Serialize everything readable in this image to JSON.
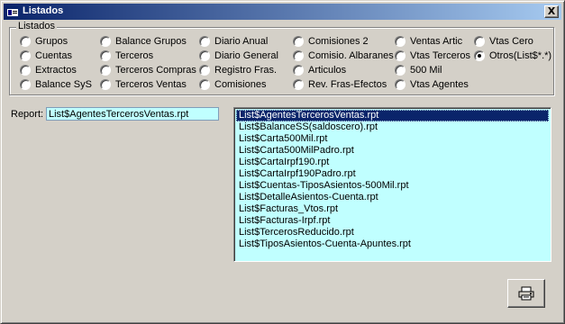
{
  "window": {
    "title": "Listados",
    "close_label": "X"
  },
  "group": {
    "label": "Listados",
    "options": [
      {
        "label": "Grupos",
        "checked": false
      },
      {
        "label": "Cuentas",
        "checked": false
      },
      {
        "label": "Extractos",
        "checked": false
      },
      {
        "label": "Balance SyS",
        "checked": false
      },
      {
        "label": "Balance Grupos",
        "checked": false
      },
      {
        "label": "Terceros",
        "checked": false
      },
      {
        "label": "Terceros Compras",
        "checked": false
      },
      {
        "label": "Terceros Ventas",
        "checked": false
      },
      {
        "label": "Diario Anual",
        "checked": false
      },
      {
        "label": "Diario General",
        "checked": false
      },
      {
        "label": "Registro Fras.",
        "checked": false
      },
      {
        "label": "Comisiones",
        "checked": false
      },
      {
        "label": "Comisiones 2",
        "checked": false
      },
      {
        "label": "Comisio. Albaranes",
        "checked": false
      },
      {
        "label": "Articulos",
        "checked": false
      },
      {
        "label": "Rev. Fras-Efectos",
        "checked": false
      },
      {
        "label": "Ventas Artic",
        "checked": false
      },
      {
        "label": "Vtas Terceros",
        "checked": false
      },
      {
        "label": "500 Mil",
        "checked": false
      },
      {
        "label": "Vtas Agentes",
        "checked": false
      },
      {
        "label": "Vtas Cero",
        "checked": false
      },
      {
        "label": "Otros(List$*.*)",
        "checked": true
      }
    ]
  },
  "report": {
    "label": "Report:",
    "value": "List$AgentesTercerosVentas.rpt"
  },
  "files": {
    "selected_index": 0,
    "items": [
      "List$AgentesTercerosVentas.rpt",
      "List$BalanceSS(saldoscero).rpt",
      "List$Carta500Mil.rpt",
      "List$Carta500MilPadro.rpt",
      "List$CartaIrpf190.rpt",
      "List$CartaIrpf190Padro.rpt",
      "List$Cuentas-TiposAsientos-500Mil.rpt",
      "List$DetalleAsientos-Cuenta.rpt",
      "List$Facturas_Vtos.rpt",
      "List$Facturas-Irpf.rpt",
      "List$TercerosReducido.rpt",
      "List$TiposAsientos-Cuenta-Apuntes.rpt"
    ]
  },
  "print_button": {
    "icon": "printer-icon"
  }
}
